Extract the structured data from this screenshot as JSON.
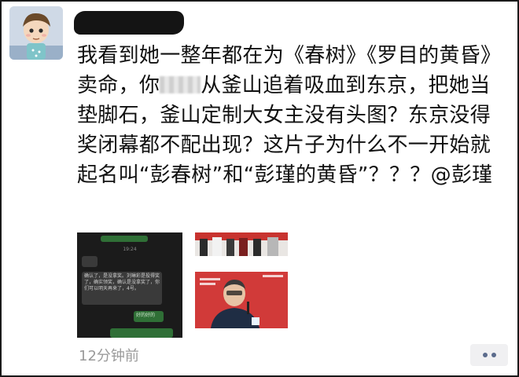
{
  "post": {
    "text": "我看到她一整年都在为《春树》《罗目的黄昏》卖命，你",
    "text_after_redaction": "从釜山追着吸血到东京，把她当垫脚石，釜山定制大女主没有头图？东京没得奖闭幕都不配出现？这片子为什么不一开始就起名叫“彭春树”和“彭瑾的黄昏”？？？@彭瑾",
    "timestamp": "12分钟前"
  },
  "images": {
    "chat_screenshot": {
      "time": "19:24",
      "messages": [
        "确认了，是没拿奖。刘琳彩是投得奖了，确实领奖，确认是没拿奖了，你们可以明天再来了，4号。",
        "好的好的"
      ]
    }
  },
  "icons": {
    "more": "more-dots-icon",
    "avatar": "avatar-cartoon-boy"
  },
  "colors": {
    "text": "#111111",
    "timestamp": "#9a9a9a",
    "more_dots": "#5b6b8c",
    "redaction": "#141414"
  }
}
